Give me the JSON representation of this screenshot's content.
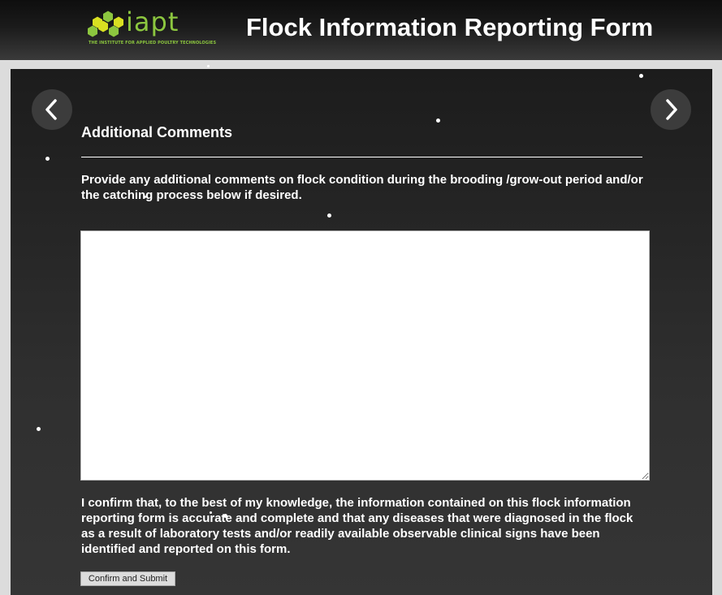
{
  "header": {
    "logo_text": "iapt",
    "logo_subtitle": "THE INSTITUTE FOR APPLIED POULTRY TECHNOLOGIES",
    "title": "Flock Information Reporting Form"
  },
  "colors": {
    "brand_green": "#8cc63f",
    "brand_yellow": "#d9e021",
    "panel_background": "#2b2b2b",
    "header_background": "#1a1a1a"
  },
  "navigation": {
    "prev_icon": "chevron-left-icon",
    "next_icon": "chevron-right-icon"
  },
  "section": {
    "title": "Additional Comments",
    "instructions": "Provide any additional comments on flock condition during the brooding /grow-out period and/or the catching process below if desired.",
    "comments_value": "",
    "confirmation": "I confirm that, to the best of my knowledge, the information contained on this flock information reporting form is accurate and complete and that any diseases that were diagnosed in the flock as a result of laboratory tests and/or readily available observable clinical signs have been identified and reported on this form.",
    "submit_label": "Confirm and Submit"
  }
}
